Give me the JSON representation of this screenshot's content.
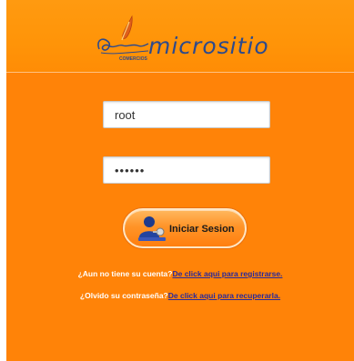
{
  "header": {
    "logo_text": "micrositio",
    "logo_subtext": "COMERCIOS"
  },
  "form": {
    "username_value": "root",
    "password_value": "••••••",
    "login_label": "Iniciar Sesion",
    "login_icon": "user-key-icon"
  },
  "links": {
    "register_prompt": "¿Aun no tiene su cuenta?",
    "register_link": "De click aqui para registrarse.",
    "recover_prompt": "¿Olvido su contraseña?",
    "recover_link": "De click aqui para recuperarla."
  },
  "colors": {
    "background": "#ff8308",
    "header": "#ff9408",
    "logo_text": "#2d4a8c",
    "link": "#2a2a9a"
  }
}
